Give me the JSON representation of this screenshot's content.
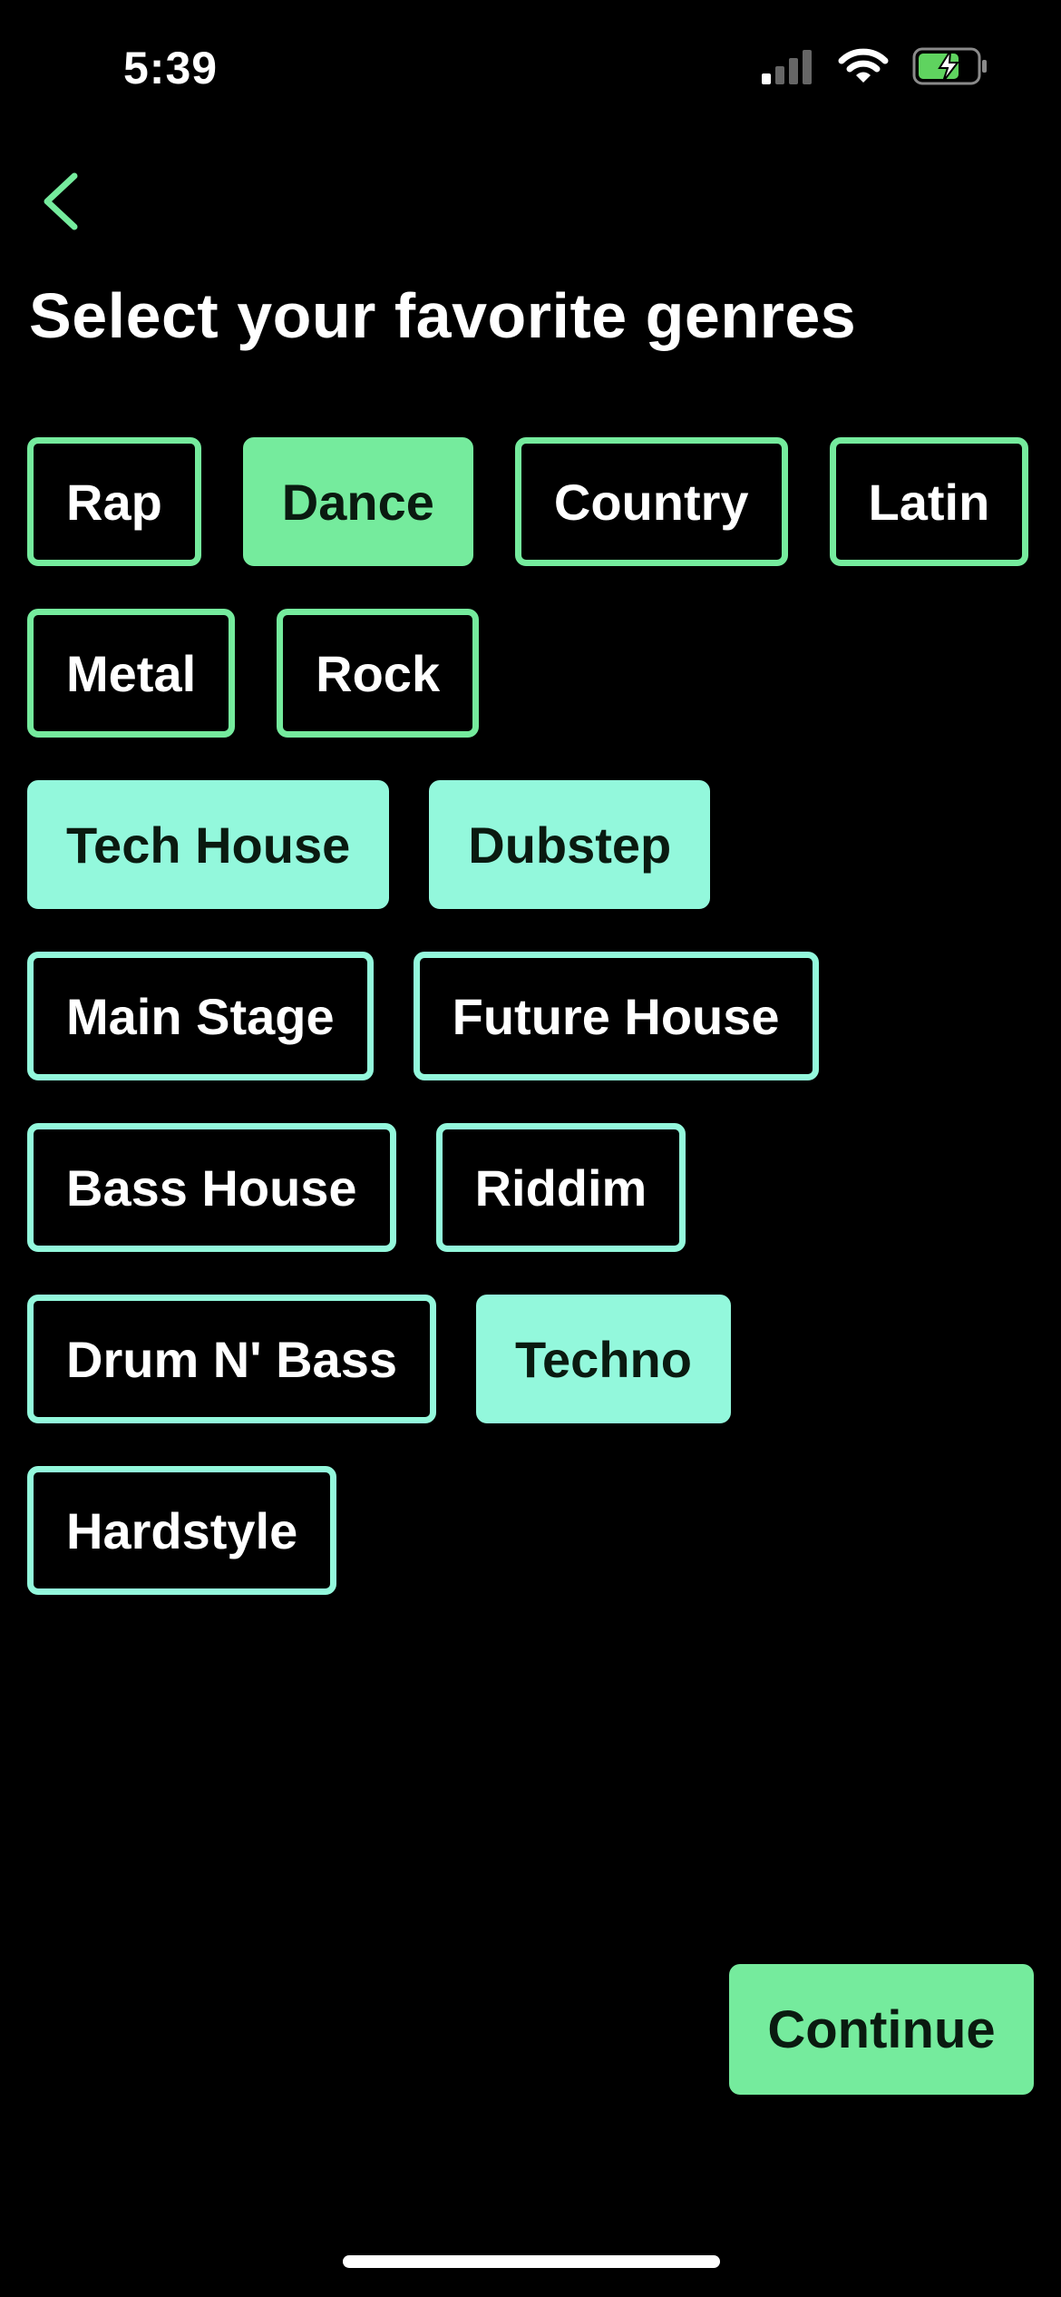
{
  "status_bar": {
    "time": "5:39"
  },
  "title": "Select your favorite genres",
  "genres": [
    {
      "label": "Rap",
      "selected": false
    },
    {
      "label": "Dance",
      "selected": true
    },
    {
      "label": "Country",
      "selected": false
    },
    {
      "label": "Latin",
      "selected": false
    },
    {
      "label": "Metal",
      "selected": false
    },
    {
      "label": "Rock",
      "selected": false
    },
    {
      "label": "Tech House",
      "selected": true
    },
    {
      "label": "Dubstep",
      "selected": true
    },
    {
      "label": "Main Stage",
      "selected": false
    },
    {
      "label": "Future House",
      "selected": false
    },
    {
      "label": "Bass House",
      "selected": false
    },
    {
      "label": "Riddim",
      "selected": false
    },
    {
      "label": "Drum N' Bass",
      "selected": false
    },
    {
      "label": "Techno",
      "selected": true
    },
    {
      "label": "Hardstyle",
      "selected": false
    }
  ],
  "continue_label": "Continue",
  "colors": {
    "accent_green": "#75EB9D",
    "accent_teal": "#93F8DC",
    "background": "#000000"
  }
}
